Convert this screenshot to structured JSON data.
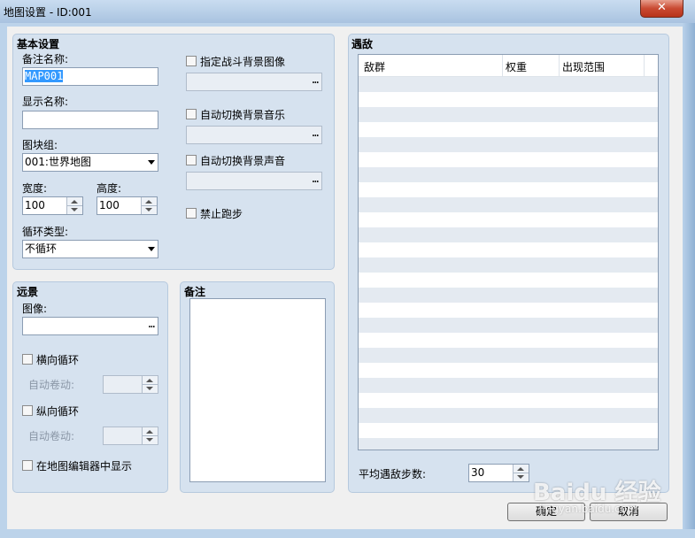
{
  "window": {
    "title": "地图设置 - ID:001",
    "close_glyph": "✕"
  },
  "basic": {
    "title": "基本设置",
    "note_name_label": "备注名称:",
    "note_name_value": "MAP001",
    "display_name_label": "显示名称:",
    "display_name_value": "",
    "tileset_label": "图块组:",
    "tileset_value": "001:世界地图",
    "width_label": "宽度:",
    "width_value": "100",
    "height_label": "高度:",
    "height_value": "100",
    "loop_label": "循环类型:",
    "loop_value": "不循环",
    "battleback_label": "指定战斗背景图像",
    "battleback_checked": false,
    "autobgm_label": "自动切换背景音乐",
    "autobgm_checked": false,
    "autobgs_label": "自动切换背景声音",
    "autobgs_checked": false,
    "nodash_label": "禁止跑步",
    "nodash_checked": false,
    "ellipsis": "…"
  },
  "parallax": {
    "title": "远景",
    "image_label": "图像:",
    "image_value": "",
    "hloop_label": "横向循环",
    "hloop_checked": false,
    "hscroll_label": "自动卷动:",
    "vloop_label": "纵向循环",
    "vloop_checked": false,
    "vscroll_label": "自动卷动:",
    "show_in_editor_label": "在地图编辑器中显示",
    "show_in_editor_checked": false
  },
  "note": {
    "title": "备注",
    "value": ""
  },
  "encounters": {
    "title": "遇敌",
    "columns": [
      "敌群",
      "权重",
      "出现范围"
    ],
    "rows": [],
    "avg_steps_label": "平均遇敌步数:",
    "avg_steps_value": "30"
  },
  "buttons": {
    "ok": "确定",
    "cancel": "取消"
  },
  "watermark": {
    "logo": "Baidu 经验",
    "url": "jingyan.baidu.com"
  }
}
